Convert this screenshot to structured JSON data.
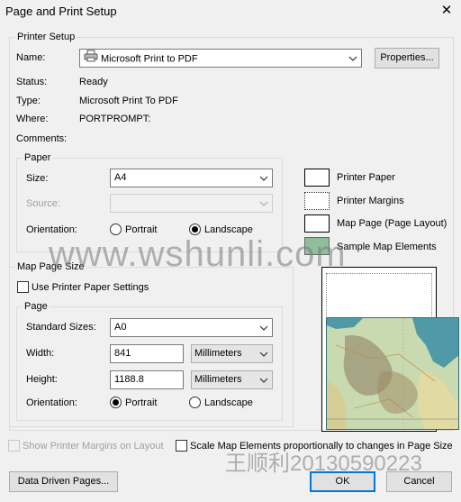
{
  "window": {
    "title": "Page and Print Setup",
    "close_glyph": "✕"
  },
  "printer_setup": {
    "legend": "Printer Setup",
    "name_label": "Name:",
    "name_value": "Microsoft Print to PDF",
    "properties_button": "Properties...",
    "status_label": "Status:",
    "status_value": "Ready",
    "type_label": "Type:",
    "type_value": "Microsoft Print To PDF",
    "where_label": "Where:",
    "where_value": "PORTPROMPT:",
    "comments_label": "Comments:",
    "comments_value": ""
  },
  "paper": {
    "legend": "Paper",
    "size_label": "Size:",
    "size_value": "A4",
    "source_label": "Source:",
    "source_value": "",
    "orientation_label": "Orientation:",
    "portrait_label": "Portrait",
    "landscape_label": "Landscape",
    "selected_orientation": "Landscape"
  },
  "legend_panel": {
    "printer_paper": "Printer Paper",
    "printer_margins": "Printer Margins",
    "map_page": "Map Page (Page Layout)",
    "sample_map_elements": "Sample Map Elements"
  },
  "map_page_size": {
    "legend": "Map Page Size",
    "use_printer_paper_label": "Use Printer Paper Settings",
    "use_printer_paper_checked": false
  },
  "page": {
    "legend": "Page",
    "standard_sizes_label": "Standard Sizes:",
    "standard_sizes_value": "A0",
    "width_label": "Width:",
    "width_value": "841",
    "width_unit": "Millimeters",
    "height_label": "Height:",
    "height_value": "1188.8",
    "height_unit": "Millimeters",
    "orientation_label": "Orientation:",
    "portrait_label": "Portrait",
    "landscape_label": "Landscape",
    "selected_orientation": "Portrait"
  },
  "options": {
    "show_margins_label": "Show Printer Margins on Layout",
    "show_margins_enabled": false,
    "scale_elements_label": "Scale Map Elements proportionally to changes in Page Size",
    "scale_elements_checked": false
  },
  "footer": {
    "data_driven_pages_button": "Data Driven Pages...",
    "ok_button": "OK",
    "cancel_button": "Cancel"
  },
  "watermarks": {
    "site": "www.wshunli.com",
    "author": "王顺利20130590223"
  },
  "colors": {
    "dialog_bg": "#f0f0f0",
    "accent": "#0078d7",
    "map_sea": "#4f9aa6"
  }
}
